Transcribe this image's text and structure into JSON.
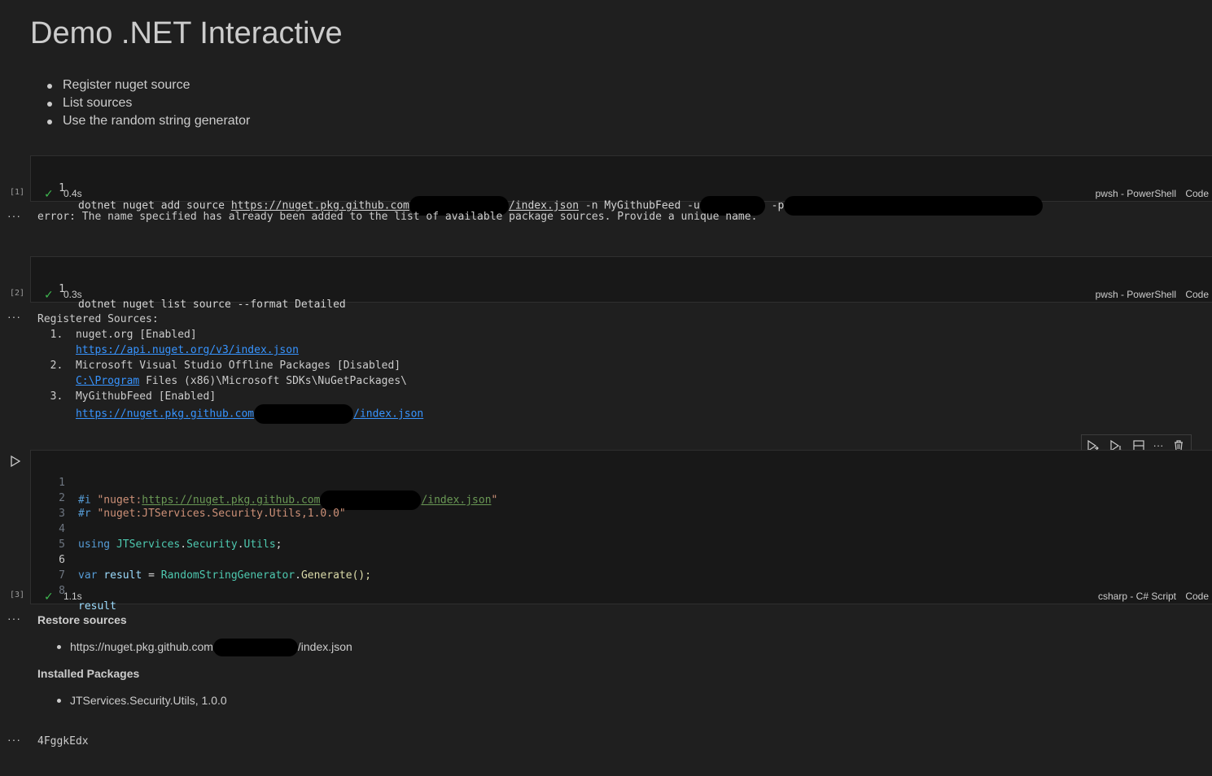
{
  "title": "Demo .NET Interactive",
  "bullets": [
    "Register nuget source",
    "List sources",
    "Use the random string generator"
  ],
  "cell1": {
    "exec_count": "[1]",
    "line_no": "1",
    "code_prefix": "dotnet nuget add source ",
    "code_url": "https://nuget.pkg.github.com",
    "code_url_suffix": "/index.json",
    "code_n": " -n MyGithubFeed -u",
    "code_p": " -p",
    "duration": "0.4s",
    "kernel": "pwsh - PowerShell",
    "lang": "Code",
    "output": "error: The name specified has already been added to the list of available package sources. Provide a unique name."
  },
  "cell2": {
    "exec_count": "[2]",
    "line_no": "1",
    "code": "dotnet nuget list source --format Detailed",
    "duration": "0.3s",
    "kernel": "pwsh - PowerShell",
    "lang": "Code",
    "output": {
      "header": "Registered Sources:",
      "sources": [
        {
          "num": "1.",
          "name": "nuget.org [Enabled]",
          "url": "https://api.nuget.org/v3/index.json"
        },
        {
          "num": "2.",
          "name": "Microsoft Visual Studio Offline Packages [Disabled]",
          "url_link": "C:\\Program",
          "url_rest": " Files (x86)\\Microsoft SDKs\\NuGetPackages\\"
        },
        {
          "num": "3.",
          "name": "MyGithubFeed [Enabled]",
          "url": "https://nuget.pkg.github.com",
          "url_suffix": "/index.json"
        }
      ]
    }
  },
  "cell3": {
    "exec_count": "[3]",
    "lines": [
      {
        "n": "1",
        "a": "#i ",
        "b": "\"nuget:",
        "c": "https://nuget.pkg.github.com",
        "d": "/index.json",
        "e": "\""
      },
      {
        "n": "2",
        "a": "#r ",
        "b": "\"nuget:JTServices.Security.Utils,1.0.0\""
      },
      {
        "n": "3"
      },
      {
        "n": "4",
        "a": "using ",
        "b": "JTServices",
        "c": ".",
        "d": "Security",
        "e": ".",
        "f": "Utils",
        "g": ";"
      },
      {
        "n": "5"
      },
      {
        "n": "6",
        "a": "var ",
        "b": "result",
        "c": " = ",
        "d": "RandomStringGenerator",
        "e": ".",
        "f": "Generate",
        "g": "();"
      },
      {
        "n": "7"
      },
      {
        "n": "8",
        "a": "result"
      }
    ],
    "duration": "1.1s",
    "kernel": "csharp - C# Script",
    "lang": "Code",
    "restore_heading": "Restore sources",
    "restore_url": "https://nuget.pkg.github.com",
    "restore_suffix": "/index.json",
    "installed_heading": "Installed Packages",
    "package": "JTServices.Security.Utils, 1.0.0",
    "result": "4FggkEdx"
  },
  "ellipsis": "···",
  "icons": {
    "run": "run-icon",
    "run_below": "run-below-icon",
    "split": "split-cell-icon",
    "more": "more-icon",
    "delete": "delete-icon",
    "check": "check-icon",
    "execute": "execute-cell-icon"
  },
  "colors": {
    "background": "#1f1f1f",
    "cell": "#181818",
    "success": "#3fb950",
    "link": "#3794ff"
  }
}
